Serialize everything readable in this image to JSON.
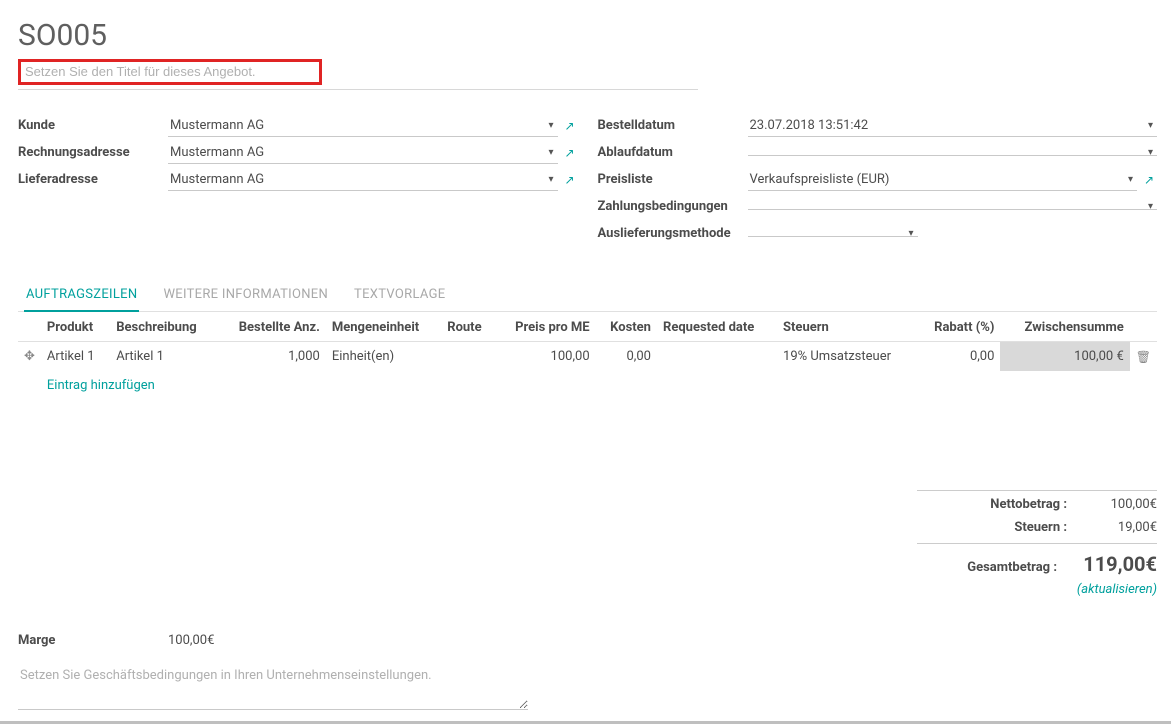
{
  "header": {
    "doc_number": "SO005",
    "title_placeholder": "Setzen Sie den Titel für dieses Angebot."
  },
  "left_fields": {
    "customer_label": "Kunde",
    "customer_value": "Mustermann AG",
    "invoice_label": "Rechnungsadresse",
    "invoice_value": "Mustermann AG",
    "delivery_label": "Lieferadresse",
    "delivery_value": "Mustermann AG"
  },
  "right_fields": {
    "orderdate_label": "Bestelldatum",
    "orderdate_value": "23.07.2018 13:51:42",
    "expiry_label": "Ablaufdatum",
    "expiry_value": "",
    "pricelist_label": "Preisliste",
    "pricelist_value": "Verkaufspreisliste (EUR)",
    "payment_label": "Zahlungsbedingungen",
    "payment_value": "",
    "shipping_label": "Auslieferungsmethode",
    "shipping_value": ""
  },
  "tabs": {
    "t1": "AUFTRAGSZEILEN",
    "t2": "WEITERE INFORMATIONEN",
    "t3": "TEXTVORLAGE"
  },
  "columns": {
    "product": "Produkt",
    "description": "Beschreibung",
    "qty": "Bestellte Anz.",
    "uom": "Mengeneinheit",
    "route": "Route",
    "price": "Preis pro ME",
    "cost": "Kosten",
    "reqdate": "Requested date",
    "taxes": "Steuern",
    "discount": "Rabatt (%)",
    "subtotal": "Zwischensumme"
  },
  "lines": [
    {
      "product": "Artikel 1",
      "description": "Artikel 1",
      "qty": "1,000",
      "uom": "Einheit(en)",
      "route": "",
      "price": "100,00",
      "cost": "0,00",
      "reqdate": "",
      "taxes": "19% Umsatzsteuer",
      "discount": "0,00",
      "subtotal": "100,00 €"
    }
  ],
  "add_line": "Eintrag hinzufügen",
  "totals": {
    "net_label": "Nettobetrag :",
    "net_value": "100,00€",
    "tax_label": "Steuern :",
    "tax_value": "19,00€",
    "grand_label": "Gesamtbetrag :",
    "grand_value": "119,00€",
    "update": "(aktualisieren)"
  },
  "margin": {
    "label": "Marge",
    "value": "100,00€"
  },
  "terms_placeholder": "Setzen Sie Geschäftsbedingungen in Ihren Unternehmenseinstellungen."
}
